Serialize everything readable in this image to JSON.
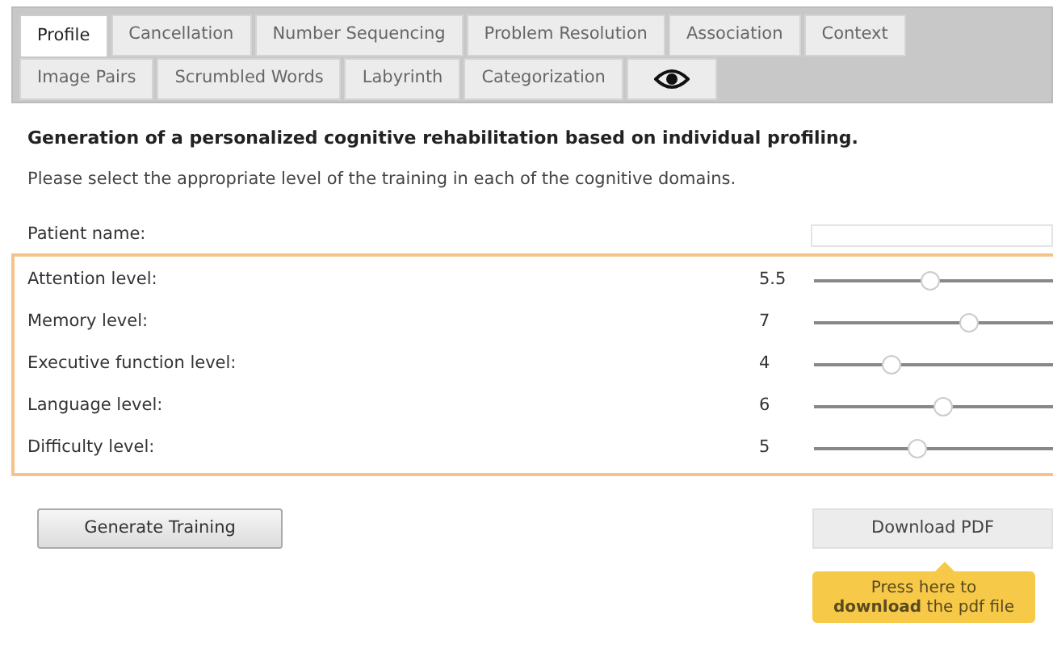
{
  "tabs": [
    {
      "label": "Profile",
      "selected": true,
      "kind": "text"
    },
    {
      "label": "Cancellation",
      "selected": false,
      "kind": "text"
    },
    {
      "label": "Number Sequencing",
      "selected": false,
      "kind": "text"
    },
    {
      "label": "Problem Resolution",
      "selected": false,
      "kind": "text"
    },
    {
      "label": "Association",
      "selected": false,
      "kind": "text"
    },
    {
      "label": "Context",
      "selected": false,
      "kind": "text"
    },
    {
      "label": "Image Pairs",
      "selected": false,
      "kind": "text"
    },
    {
      "label": "Scrumbled Words",
      "selected": false,
      "kind": "text"
    },
    {
      "label": "Labyrinth",
      "selected": false,
      "kind": "text"
    },
    {
      "label": "Categorization",
      "selected": false,
      "kind": "text"
    },
    {
      "selected": false,
      "kind": "eye"
    }
  ],
  "heading": "Generation of a personalized cognitive rehabilitation based on individual profiling.",
  "instructions": "Please select the appropriate level of the training in each of the cognitive domains.",
  "patient_name": {
    "label": "Patient name:"
  },
  "levels": [
    {
      "label": "Attention level:",
      "reading": "5.5",
      "level": 0.5
    },
    {
      "label": "Memory level:",
      "reading": "7",
      "level": 0.667
    },
    {
      "label": "Executive function level:",
      "reading": "4",
      "level": 0.333
    },
    {
      "label": "Language level:",
      "reading": "6",
      "level": 0.556
    },
    {
      "label": "Difficulty level:",
      "reading": "5",
      "level": 0.444
    }
  ],
  "generate_button": "Generate Training",
  "download_button": "Download PDF",
  "tooltip": "Press here to **download** the pdf file"
}
